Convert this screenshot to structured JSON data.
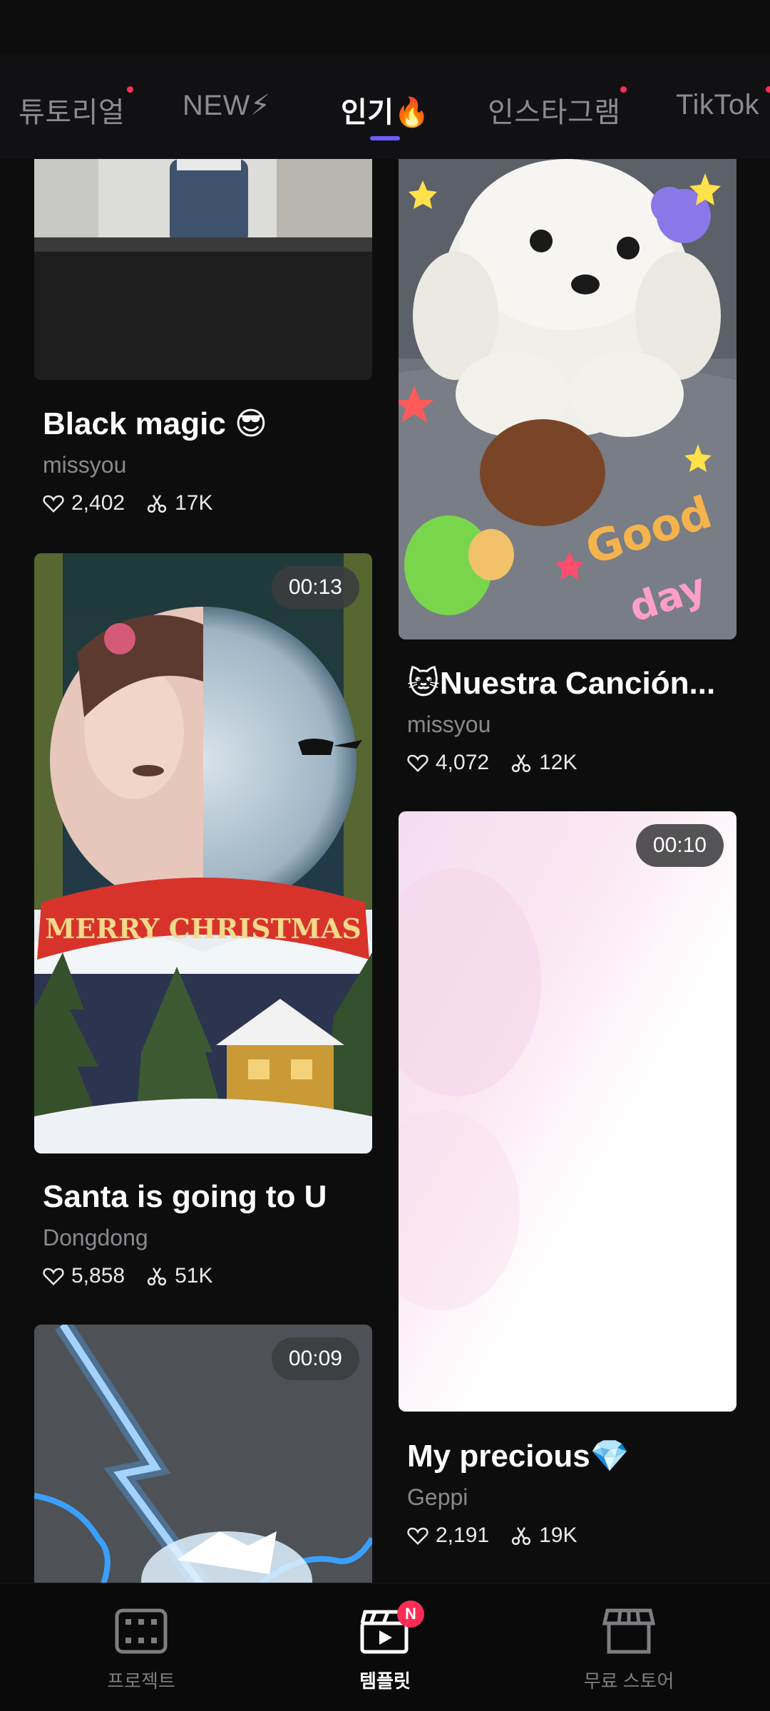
{
  "tabs": [
    {
      "label": "튜토리얼",
      "dot": true
    },
    {
      "label": "NEW⚡",
      "dot": false
    },
    {
      "label": "인기🔥",
      "dot": false,
      "active": true
    },
    {
      "label": "인스타그램",
      "dot": true
    },
    {
      "label": "TikTok",
      "dot": true
    }
  ],
  "cards": {
    "black_magic": {
      "title": "Black magic 😎",
      "author": "missyou",
      "likes": "2,402",
      "uses": "17K"
    },
    "nuestra": {
      "title": "🐱Nuestra Canción...",
      "author": "missyou",
      "likes": "4,072",
      "uses": "12K",
      "thumb_text": "Good day"
    },
    "santa": {
      "title": "Santa is going to U",
      "author": "Dongdong",
      "likes": "5,858",
      "uses": "51K",
      "duration": "00:13",
      "thumb_text": "MERRY CHRISTMAS"
    },
    "precious": {
      "title": "My precious💎",
      "author": "Geppi",
      "likes": "2,191",
      "uses": "19K",
      "duration": "00:10"
    },
    "lightning": {
      "duration": "00:09"
    }
  },
  "bottom_nav": [
    {
      "label": "프로젝트",
      "icon": "film-icon"
    },
    {
      "label": "템플릿",
      "icon": "clapperboard-icon",
      "badge": "N",
      "active": true
    },
    {
      "label": "무료 스토어",
      "icon": "store-icon"
    }
  ],
  "colors": {
    "accent": "#6f5cff",
    "badge": "#ff2d55",
    "background": "#0d0d0e"
  }
}
